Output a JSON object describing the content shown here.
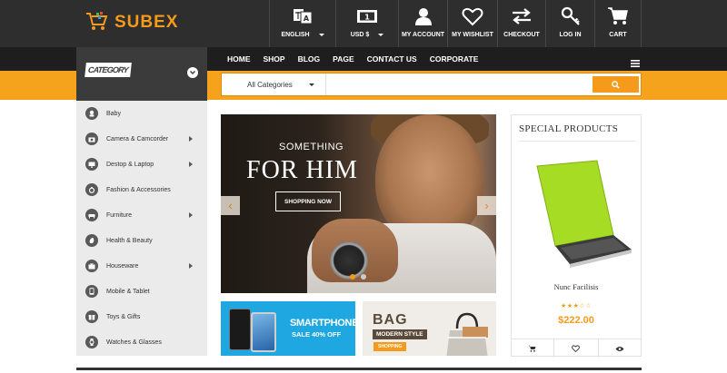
{
  "brand": {
    "name": "SUBEX",
    "accent": "#f59a1b",
    "header_bg": "#2e2e2e"
  },
  "header": {
    "language": {
      "label": "ENGLISH",
      "icon": "translate-icon"
    },
    "currency": {
      "label": "USD $",
      "icon": "banknote-icon"
    },
    "account": {
      "label": "MY ACCOUNT",
      "icon": "user-icon"
    },
    "wishlist": {
      "label": "MY WISHLIST",
      "icon": "heart-icon"
    },
    "checkout": {
      "label": "CHECKOUT",
      "icon": "exchange-arrows-icon"
    },
    "login": {
      "label": "LOG IN",
      "icon": "key-icon"
    },
    "cart": {
      "label": "CART",
      "icon": "cart-icon"
    }
  },
  "nav": {
    "category_heading": "CATEGORY",
    "links": [
      "HOME",
      "SHOP",
      "BLOG",
      "PAGE",
      "CONTACT US",
      "CORPORATE"
    ]
  },
  "search": {
    "category": "All Categories",
    "placeholder": ""
  },
  "categories": [
    {
      "label": "Baby",
      "icon": "baby-icon",
      "has_sub": false
    },
    {
      "label": "Camera & Camcorder",
      "icon": "camera-icon",
      "has_sub": true
    },
    {
      "label": "Destop & Laptop",
      "icon": "monitor-icon",
      "has_sub": true
    },
    {
      "label": "Fashion & Accessories",
      "icon": "ring-icon",
      "has_sub": false
    },
    {
      "label": "Furniture",
      "icon": "sofa-icon",
      "has_sub": true
    },
    {
      "label": "Health & Beauty",
      "icon": "beauty-icon",
      "has_sub": false
    },
    {
      "label": "Houseware",
      "icon": "tv-icon",
      "has_sub": true
    },
    {
      "label": "Mobile & Tablet",
      "icon": "mobile-icon",
      "has_sub": false
    },
    {
      "label": "Toys & Gifts",
      "icon": "gift-icon",
      "has_sub": false
    },
    {
      "label": "Watches & Glasses",
      "icon": "watch-icon",
      "has_sub": false
    }
  ],
  "slider": {
    "small_text": "SOMETHING",
    "big_text": "FOR HIM",
    "button": "SHOPPING NOW",
    "prev": "‹",
    "next": "›",
    "active_slide": 1,
    "slide_count": 2
  },
  "banners": {
    "smartphone": {
      "title": "SMARTPHONE",
      "subtitle": "SALE 40% OFF"
    },
    "bag": {
      "title": "BAG",
      "subtitle": "MODERN STYLE",
      "button": "SHOPPING"
    }
  },
  "special_products": {
    "title": "SPECIAL PRODUCTS",
    "product": {
      "name": "Nunc Facilisis",
      "price": "$222.00",
      "rating": 3,
      "rating_max": 5
    }
  }
}
